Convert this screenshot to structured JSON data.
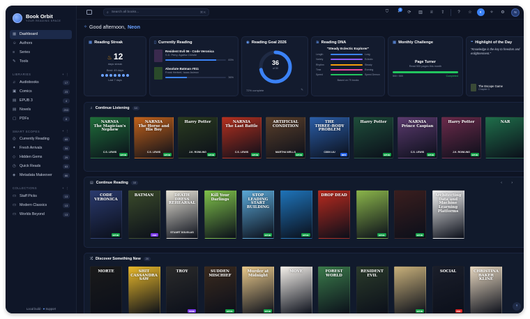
{
  "brand": {
    "name": "Book Orbit",
    "tagline": "YOUR READING SPACE"
  },
  "nav": [
    {
      "label": "Dashboard",
      "icon": "grid-icon",
      "active": true
    },
    {
      "label": "Authors",
      "icon": "user-icon"
    },
    {
      "label": "Series",
      "icon": "layers-icon"
    },
    {
      "label": "Tools",
      "icon": "wrench-icon"
    }
  ],
  "libraries": {
    "title": "LIBRARIES",
    "items": [
      {
        "label": "Audiobooks",
        "count": "17"
      },
      {
        "label": "Comics",
        "count": "23"
      },
      {
        "label": "EPUB 3",
        "count": "4"
      },
      {
        "label": "Novels",
        "count": "253"
      },
      {
        "label": "PDFs",
        "count": "8"
      }
    ]
  },
  "smart_scopes": {
    "title": "SMART SCOPES",
    "items": [
      {
        "label": "Currently Reading",
        "count": "65"
      },
      {
        "label": "Fresh Arrivals",
        "count": "34"
      },
      {
        "label": "Hidden Gems",
        "count": "29"
      },
      {
        "label": "Quick Reads",
        "count": "63"
      },
      {
        "label": "Metadata Makeover",
        "count": "86"
      }
    ]
  },
  "collections": {
    "title": "COLLECTIONS",
    "items": [
      {
        "label": "Staff Picks",
        "count": "13"
      },
      {
        "label": "Modern Classics",
        "count": "13"
      },
      {
        "label": "Worlds Beyond",
        "count": "13"
      }
    ]
  },
  "footer": {
    "left": "Local build",
    "right": "Support"
  },
  "topbar": {
    "search_placeholder": "Search all books...",
    "shortcut": "⌘ K",
    "notif_count": "2",
    "avatar": "N"
  },
  "greeting": {
    "prefix": "Good afternoon,",
    "name": "Neon"
  },
  "streak": {
    "title": "Reading Streak",
    "value": "12",
    "unit": "days streak",
    "best": "Best: 49 days",
    "last": "Last 7 days"
  },
  "current": {
    "title": "Currently Reading",
    "books": [
      {
        "title": "Resident Evil 06 - Code Veronica",
        "author": "S.D. Perry, Agatha Christie",
        "pct": "83%",
        "progress": 0.83
      },
      {
        "title": "Absolute Batman #011",
        "author": "Frank Herbert, Isaac Asimov",
        "pct": "36%",
        "progress": 0.36
      }
    ]
  },
  "goal": {
    "title": "Reading Goal 2026",
    "value": "36",
    "of": "of 50",
    "complete": "72% complete",
    "progress": 0.72
  },
  "dna": {
    "title": "Reading DNA",
    "quote": "\"Steady Eclectic Explorer\"",
    "rows": [
      {
        "left": "Length",
        "right": "Long",
        "color": "#3b82f6"
      },
      {
        "left": "Variety",
        "right": "Eclectic",
        "color": "#8b5cf6"
      },
      {
        "left": "Rhythm",
        "right": "Steady",
        "color": "#f59e0b"
      },
      {
        "left": "Time",
        "right": "Evening",
        "color": "#ec4899"
      },
      {
        "left": "Speed",
        "right": "Speed Demon",
        "color": "#22c55e"
      }
    ],
    "foot": "Based on 79 books"
  },
  "challenge": {
    "title": "Monthly Challenge",
    "name": "Page Turner",
    "sub": "Read 500 pages this month",
    "count": "500 / 500",
    "status": "Completed",
    "progress": 1.0
  },
  "highlight": {
    "title": "Highlight of the Day",
    "quote": "\"Knowledge is the key to freedom and enlightenment.\"",
    "book": "The Escape Game",
    "chapter": "Chapter 3"
  },
  "continue_listening": {
    "title": "Continue Listening",
    "count": "14",
    "books": [
      {
        "title": "NARNIA\nThe Magician's Nephew",
        "author": "C.S. LEWIS",
        "bg": "#1f6e3a",
        "tag": "EPUB",
        "tagc": ""
      },
      {
        "title": "NARNIA\nThe Horse and His Boy",
        "author": "C.S. LEWIS",
        "bg": "#c2621b",
        "tag": "EPUB",
        "tagc": ""
      },
      {
        "title": "Harry Potter",
        "author": "J.K. ROWLING",
        "bg": "#2a3b1f",
        "tag": "EPUB",
        "tagc": ""
      },
      {
        "title": "NARNIA\nThe Last Battle",
        "author": "C.S. LEWIS",
        "bg": "#b5301f",
        "tag": "EPUB",
        "tagc": ""
      },
      {
        "title": "ARTIFICIAL\nCONDITION",
        "author": "MARTHA WELLS",
        "bg": "#5a3f2a",
        "tag": "EPUB",
        "tagc": ""
      },
      {
        "title": "THE\nTHREE-BODY\nPROBLEM",
        "author": "CIXIN LIU",
        "bg": "#2b5ea8",
        "tag": "MP3",
        "tagc": "blue"
      },
      {
        "title": "Harry Potter",
        "author": "",
        "bg": "#1e4d3a",
        "tag": "EPUB",
        "tagc": ""
      },
      {
        "title": "NARNIA\nPrince Caspian",
        "author": "C.S. LEWIS",
        "bg": "#5b3a6e",
        "tag": "EPUB",
        "tagc": ""
      },
      {
        "title": "Harry Potter",
        "author": "J.K. ROWLING",
        "bg": "#6b2a4a",
        "tag": "EPUB",
        "tagc": ""
      },
      {
        "title": "NAR",
        "author": "",
        "bg": "#1f6e4a",
        "tag": "",
        "tagc": ""
      }
    ]
  },
  "continue_reading": {
    "title": "Continue Reading",
    "count": "10",
    "books": [
      {
        "title": "CODE VERONICA",
        "author": "",
        "bg": "#2a3a6e",
        "tag": "EPUB",
        "tagc": ""
      },
      {
        "title": "BATMAN",
        "author": "",
        "bg": "#3a4a2a",
        "tag": "CBZ",
        "tagc": "purple"
      },
      {
        "title": "DEATH DRESS REHEARSAL",
        "author": "STUART DOUGLAS",
        "bg": "#e8e4d8",
        "tag": "",
        "tagc": ""
      },
      {
        "title": "Kill Your Darlings",
        "author": "",
        "bg": "#7fc24a",
        "tag": "",
        "tagc": ""
      },
      {
        "title": "STOP LEADING START BUILDING",
        "author": "",
        "bg": "#5aa7d6",
        "tag": "EPUB",
        "tagc": ""
      },
      {
        "title": "",
        "author": "",
        "bg": "#1e73b8",
        "tag": "EPUB",
        "tagc": ""
      },
      {
        "title": "DROP DEAD",
        "author": "",
        "bg": "#b82a1e",
        "tag": "",
        "tagc": ""
      },
      {
        "title": "",
        "author": "",
        "bg": "#8ab44a",
        "tag": "EPUB",
        "tagc": ""
      },
      {
        "title": "",
        "author": "",
        "bg": "#3a1e1e",
        "tag": "EPUB",
        "tagc": ""
      },
      {
        "title": "Architecting Data and Machine Learning Platforms",
        "author": "",
        "bg": "#f2f2f2",
        "tag": "",
        "tagc": ""
      }
    ]
  },
  "discover": {
    "title": "Discover Something New",
    "count": "20",
    "books": [
      {
        "title": "MORTE",
        "author": "",
        "bg": "#1a1a1a",
        "tag": "",
        "tagc": ""
      },
      {
        "title": "SHIT CASSANDRA SAW",
        "author": "",
        "bg": "#e8b82a",
        "tag": "",
        "tagc": ""
      },
      {
        "title": "TROY",
        "author": "",
        "bg": "#2a2a2a",
        "tag": "MOBI",
        "tagc": "purple"
      },
      {
        "title": "SUDDEN MISCHIEF",
        "author": "",
        "bg": "#3a2a1e",
        "tag": "EPUB",
        "tagc": ""
      },
      {
        "title": "Murder at Midnight",
        "author": "",
        "bg": "#e8c88a",
        "tag": "EPUB",
        "tagc": ""
      },
      {
        "title": "MOVE",
        "author": "",
        "bg": "#f4f0ea",
        "tag": "",
        "tagc": ""
      },
      {
        "title": "FOREST WORLD",
        "author": "",
        "bg": "#3a7a4a",
        "tag": "",
        "tagc": ""
      },
      {
        "title": "RESIDENT EVIL",
        "author": "",
        "bg": "#2a3a2a",
        "tag": "",
        "tagc": ""
      },
      {
        "title": "",
        "author": "",
        "bg": "#c8b07a",
        "tag": "EPUB",
        "tagc": ""
      },
      {
        "title": "SOCIAL",
        "author": "",
        "bg": "#1a1e2a",
        "tag": "PDF",
        "tagc": "red"
      },
      {
        "title": "CHRISTINA BAKER KLINE",
        "author": "",
        "bg": "#e8d8c0",
        "tag": "",
        "tagc": ""
      }
    ]
  }
}
